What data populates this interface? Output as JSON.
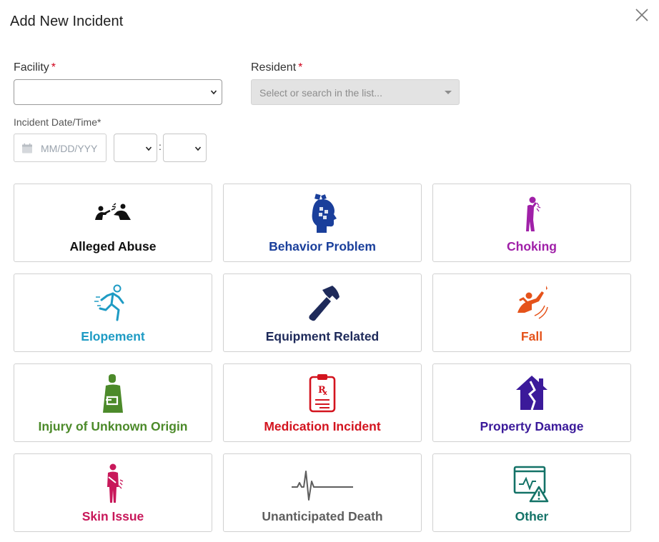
{
  "dialog": {
    "title": "Add New Incident"
  },
  "form": {
    "facility": {
      "label": "Facility",
      "required_mark": "*",
      "value": ""
    },
    "resident": {
      "label": "Resident",
      "required_mark": "*",
      "placeholder": "Select or search in the list..."
    },
    "incident_datetime": {
      "label": "Incident Date/Time*",
      "date_placeholder": "MM/DD/YYY",
      "hour_value": "",
      "minute_value": "",
      "separator": ":"
    }
  },
  "incident_types": [
    {
      "label": "Alleged Abuse",
      "icon": "alleged-abuse-icon",
      "color": "#111111"
    },
    {
      "label": "Behavior Problem",
      "icon": "brain-puzzle-icon",
      "color": "#1a3f9b"
    },
    {
      "label": "Choking",
      "icon": "choking-person-icon",
      "color": "#a020a8"
    },
    {
      "label": "Elopement",
      "icon": "running-person-icon",
      "color": "#1e9bc4"
    },
    {
      "label": "Equipment Related",
      "icon": "hammer-icon",
      "color": "#1e2a5a"
    },
    {
      "label": "Fall",
      "icon": "falling-person-icon",
      "color": "#e5531b"
    },
    {
      "label": "Injury of Unknown Origin",
      "icon": "injured-person-icon",
      "color": "#4c8a2a"
    },
    {
      "label": "Medication Incident",
      "icon": "prescription-clipboard-icon",
      "color": "#d3141f"
    },
    {
      "label": "Property Damage",
      "icon": "damaged-house-icon",
      "color": "#3b1a9a"
    },
    {
      "label": "Skin Issue",
      "icon": "scratching-person-icon",
      "color": "#c8185a"
    },
    {
      "label": "Unanticipated Death",
      "icon": "flatline-icon",
      "color": "#5e5e5e"
    },
    {
      "label": "Other",
      "icon": "monitor-warning-icon",
      "color": "#137267"
    }
  ]
}
